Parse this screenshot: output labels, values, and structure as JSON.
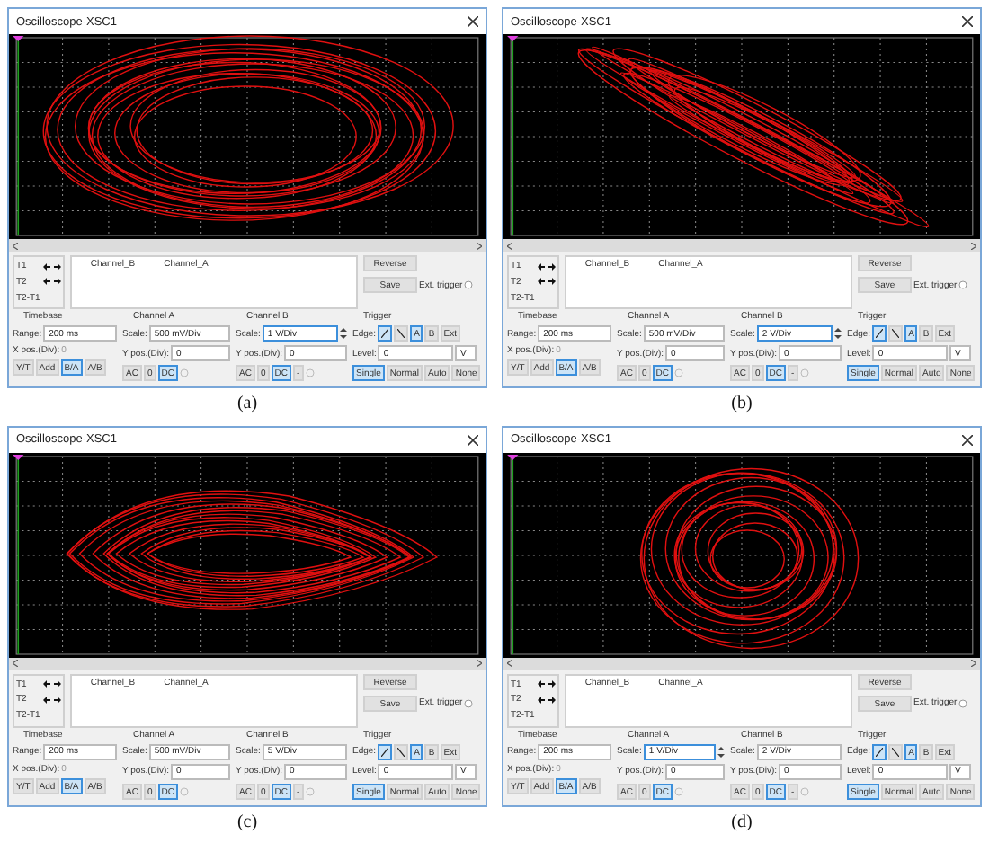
{
  "panels": [
    {
      "caption": "(a)",
      "title": "Oscilloscope-XSC1",
      "ext_trigger_on": false,
      "t1": "T1",
      "t2": "T2",
      "t21": "T2-T1",
      "columns": [
        "Channel_B",
        "Channel_A"
      ],
      "reverse": "Reverse",
      "save": "Save",
      "ext_trigger": "Ext. trigger",
      "timebase": {
        "label": "Timebase",
        "range_label": "Range:",
        "range": "200 ms",
        "xpos_label": "X pos.(Div):",
        "xpos": "0",
        "modes": [
          {
            "label": "Y/T",
            "selected": false
          },
          {
            "label": "Add",
            "selected": false
          },
          {
            "label": "B/A",
            "selected": true
          },
          {
            "label": "A/B",
            "selected": false
          }
        ]
      },
      "channels": [
        {
          "label": "Channel A",
          "scale_label": "Scale:",
          "scale": "500 mV/Div",
          "focused": false,
          "ypos_label": "Y pos.(Div):",
          "ypos": "0",
          "coupling": [
            {
              "label": "AC",
              "selected": false
            },
            {
              "label": "0",
              "selected": false
            },
            {
              "label": "DC",
              "selected": true
            }
          ]
        },
        {
          "label": "Channel B",
          "scale_label": "Scale:",
          "scale": "1 V/Div",
          "focused": true,
          "ypos_label": "Y pos.(Div):",
          "ypos": "0",
          "coupling": [
            {
              "label": "AC",
              "selected": false
            },
            {
              "label": "0",
              "selected": false
            },
            {
              "label": "DC",
              "selected": true
            },
            {
              "label": "-",
              "selected": false
            }
          ]
        }
      ],
      "trigger": {
        "label": "Trigger",
        "edge_label": "Edge:",
        "edges": [
          {
            "label": "A",
            "selected": true
          },
          {
            "label": "B",
            "selected": false
          },
          {
            "label": "Ext",
            "selected": false
          }
        ],
        "level_label": "Level:",
        "level": "0",
        "unit": "V",
        "modes": [
          {
            "label": "Single",
            "selected": true
          },
          {
            "label": "Normal",
            "selected": false
          },
          {
            "label": "Auto",
            "selected": false
          },
          {
            "label": "None",
            "selected": false
          }
        ]
      }
    },
    {
      "caption": "(b)",
      "title": "Oscilloscope-XSC1",
      "ext_trigger_on": false,
      "t1": "T1",
      "t2": "T2",
      "t21": "T2-T1",
      "columns": [
        "Channel_B",
        "Channel_A"
      ],
      "reverse": "Reverse",
      "save": "Save",
      "ext_trigger": "Ext. trigger",
      "timebase": {
        "label": "Timebase",
        "range_label": "Range:",
        "range": "200 ms",
        "xpos_label": "X pos.(Div):",
        "xpos": "0",
        "modes": [
          {
            "label": "Y/T",
            "selected": false
          },
          {
            "label": "Add",
            "selected": false
          },
          {
            "label": "B/A",
            "selected": true
          },
          {
            "label": "A/B",
            "selected": false
          }
        ]
      },
      "channels": [
        {
          "label": "Channel A",
          "scale_label": "Scale:",
          "scale": "500 mV/Div",
          "focused": false,
          "ypos_label": "Y pos.(Div):",
          "ypos": "0",
          "coupling": [
            {
              "label": "AC",
              "selected": false
            },
            {
              "label": "0",
              "selected": false
            },
            {
              "label": "DC",
              "selected": true
            }
          ]
        },
        {
          "label": "Channel B",
          "scale_label": "Scale:",
          "scale": "2 V/Div",
          "focused": true,
          "ypos_label": "Y pos.(Div):",
          "ypos": "0",
          "coupling": [
            {
              "label": "AC",
              "selected": false
            },
            {
              "label": "0",
              "selected": false
            },
            {
              "label": "DC",
              "selected": true
            },
            {
              "label": "-",
              "selected": false
            }
          ]
        }
      ],
      "trigger": {
        "label": "Trigger",
        "edge_label": "Edge:",
        "edges": [
          {
            "label": "A",
            "selected": true
          },
          {
            "label": "B",
            "selected": false
          },
          {
            "label": "Ext",
            "selected": false
          }
        ],
        "level_label": "Level:",
        "level": "0",
        "unit": "V",
        "modes": [
          {
            "label": "Single",
            "selected": true
          },
          {
            "label": "Normal",
            "selected": false
          },
          {
            "label": "Auto",
            "selected": false
          },
          {
            "label": "None",
            "selected": false
          }
        ]
      }
    },
    {
      "caption": "(c)",
      "title": "Oscilloscope-XSC1",
      "ext_trigger_on": false,
      "t1": "T1",
      "t2": "T2",
      "t21": "T2-T1",
      "columns": [
        "Channel_B",
        "Channel_A"
      ],
      "reverse": "Reverse",
      "save": "Save",
      "ext_trigger": "Ext. trigger",
      "timebase": {
        "label": "Timebase",
        "range_label": "Range:",
        "range": "200 ms",
        "xpos_label": "X pos.(Div):",
        "xpos": "0",
        "modes": [
          {
            "label": "Y/T",
            "selected": false
          },
          {
            "label": "Add",
            "selected": false
          },
          {
            "label": "B/A",
            "selected": true
          },
          {
            "label": "A/B",
            "selected": false
          }
        ]
      },
      "channels": [
        {
          "label": "Channel A",
          "scale_label": "Scale:",
          "scale": "500 mV/Div",
          "focused": false,
          "ypos_label": "Y pos.(Div):",
          "ypos": "0",
          "coupling": [
            {
              "label": "AC",
              "selected": false
            },
            {
              "label": "0",
              "selected": false
            },
            {
              "label": "DC",
              "selected": true
            }
          ]
        },
        {
          "label": "Channel B",
          "scale_label": "Scale:",
          "scale": "5 V/Div",
          "focused": false,
          "ypos_label": "Y pos.(Div):",
          "ypos": "0",
          "coupling": [
            {
              "label": "AC",
              "selected": false
            },
            {
              "label": "0",
              "selected": false
            },
            {
              "label": "DC",
              "selected": true
            },
            {
              "label": "-",
              "selected": false
            }
          ]
        }
      ],
      "trigger": {
        "label": "Trigger",
        "edge_label": "Edge:",
        "edges": [
          {
            "label": "A",
            "selected": true
          },
          {
            "label": "B",
            "selected": false
          },
          {
            "label": "Ext",
            "selected": false
          }
        ],
        "level_label": "Level:",
        "level": "0",
        "unit": "V",
        "modes": [
          {
            "label": "Single",
            "selected": true
          },
          {
            "label": "Normal",
            "selected": false
          },
          {
            "label": "Auto",
            "selected": false
          },
          {
            "label": "None",
            "selected": false
          }
        ]
      }
    },
    {
      "caption": "(d)",
      "title": "Oscilloscope-XSC1",
      "ext_trigger_on": false,
      "t1": "T1",
      "t2": "T2",
      "t21": "T2-T1",
      "columns": [
        "Channel_B",
        "Channel_A"
      ],
      "reverse": "Reverse",
      "save": "Save",
      "ext_trigger": "Ext. trigger",
      "timebase": {
        "label": "Timebase",
        "range_label": "Range:",
        "range": "200 ms",
        "xpos_label": "X pos.(Div):",
        "xpos": "0",
        "modes": [
          {
            "label": "Y/T",
            "selected": false
          },
          {
            "label": "Add",
            "selected": false
          },
          {
            "label": "B/A",
            "selected": true
          },
          {
            "label": "A/B",
            "selected": false
          }
        ]
      },
      "channels": [
        {
          "label": "Channel A",
          "scale_label": "Scale:",
          "scale": "1 V/Div",
          "focused": true,
          "ypos_label": "Y pos.(Div):",
          "ypos": "0",
          "coupling": [
            {
              "label": "AC",
              "selected": false
            },
            {
              "label": "0",
              "selected": false
            },
            {
              "label": "DC",
              "selected": true
            }
          ]
        },
        {
          "label": "Channel B",
          "scale_label": "Scale:",
          "scale": "2 V/Div",
          "focused": false,
          "ypos_label": "Y pos.(Div):",
          "ypos": "0",
          "coupling": [
            {
              "label": "AC",
              "selected": false
            },
            {
              "label": "0",
              "selected": false
            },
            {
              "label": "DC",
              "selected": true
            },
            {
              "label": "-",
              "selected": false
            }
          ]
        }
      ],
      "trigger": {
        "label": "Trigger",
        "edge_label": "Edge:",
        "edges": [
          {
            "label": "A",
            "selected": true
          },
          {
            "label": "B",
            "selected": false
          },
          {
            "label": "Ext",
            "selected": false
          }
        ],
        "level_label": "Level:",
        "level": "0",
        "unit": "V",
        "modes": [
          {
            "label": "Single",
            "selected": true
          },
          {
            "label": "Normal",
            "selected": false
          },
          {
            "label": "Auto",
            "selected": false
          },
          {
            "label": "None",
            "selected": false
          }
        ]
      }
    }
  ]
}
